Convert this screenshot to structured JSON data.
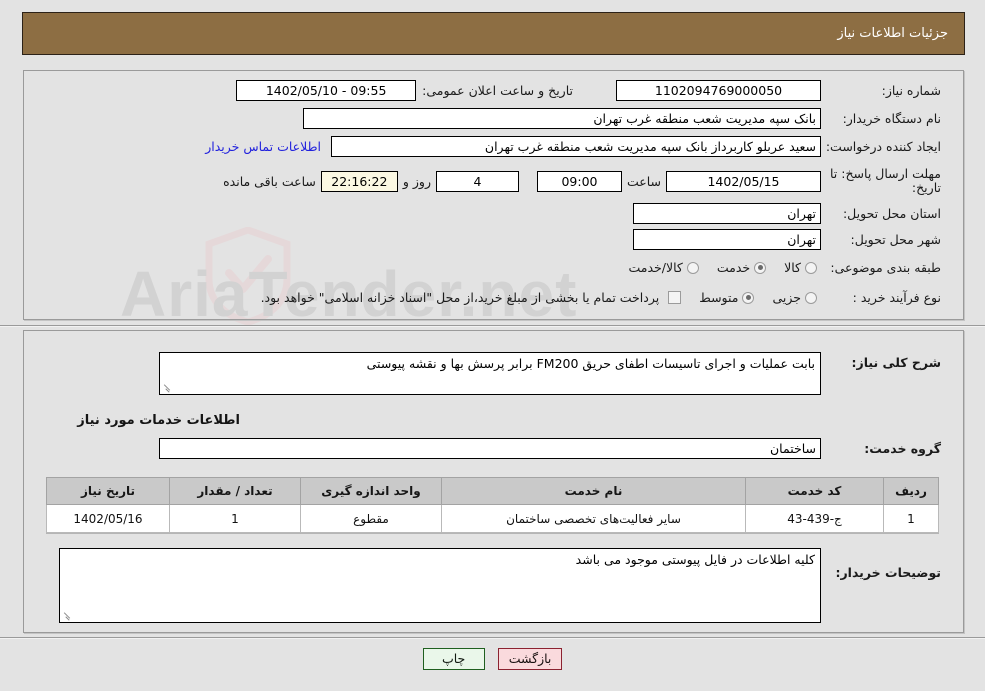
{
  "header": {
    "title": "جزئیات اطلاعات نیاز"
  },
  "watermark": {
    "text": "AriaTender.net"
  },
  "form": {
    "need_number_label": "شماره نیاز:",
    "need_number_value": "1102094769000050",
    "announce_label": "تاریخ و ساعت اعلان عمومی:",
    "announce_value": "09:55 - 1402/05/10",
    "buyer_org_label": "نام دستگاه خریدار:",
    "buyer_org_value": "بانک سپه مدیریت شعب منطقه غرب تهران",
    "creator_label": "ایجاد کننده درخواست:",
    "creator_value": "سعید عربلو کاربرداز بانک سپه مدیریت شعب منطقه غرب تهران",
    "contact_link": "اطلاعات تماس خریدار",
    "deadline_label": "مهلت ارسال پاسخ: تا تاریخ:",
    "deadline_date": "1402/05/15",
    "deadline_time_label": "ساعت",
    "deadline_time": "09:00",
    "remaining_days": "4",
    "remaining_days_label": "روز و",
    "remaining_clock": "22:16:22",
    "remaining_suffix": "ساعت باقی مانده",
    "province_label": "استان محل تحویل:",
    "province_value": "تهران",
    "city_label": "شهر محل تحویل:",
    "city_value": "تهران",
    "category_label": "طبقه بندی موضوعی:",
    "category_options": [
      {
        "label": "کالا",
        "checked": false
      },
      {
        "label": "خدمت",
        "checked": true
      },
      {
        "label": "کالا/خدمت",
        "checked": false
      }
    ],
    "process_label": "نوع فرآیند خرید :",
    "process_options": [
      {
        "label": "جزیی",
        "checked": false
      },
      {
        "label": "متوسط",
        "checked": true
      }
    ],
    "treasury_checkbox_checked": false,
    "treasury_text": "پرداخت تمام یا بخشی از مبلغ خرید،از محل \"اسناد خزانه اسلامی\" خواهد بود."
  },
  "need_desc": {
    "label": "شرح کلی نیاز:",
    "value": "بابت عملیات و اجرای تاسیسات اطفای حریق FM200 برابر پرسش بها و نقشه پیوستی"
  },
  "services": {
    "heading": "اطلاعات خدمات مورد نیاز",
    "group_label": "گروه خدمت:",
    "group_value": "ساختمان",
    "columns": [
      "ردیف",
      "کد خدمت",
      "نام خدمت",
      "واحد اندازه گیری",
      "تعداد / مقدار",
      "تاریخ نیاز"
    ],
    "rows": [
      {
        "index": "1",
        "code": "ج-439-43",
        "name": "سایر فعالیت‌های تخصصی ساختمان",
        "unit": "مقطوع",
        "quantity": "1",
        "need_date": "1402/05/16"
      }
    ]
  },
  "buyer_notes": {
    "label": "توضیحات خریدار:",
    "value": "کلیه اطلاعات در فایل پیوستی موجود می باشد"
  },
  "buttons": {
    "print": "چاپ",
    "back": "بازگشت"
  }
}
